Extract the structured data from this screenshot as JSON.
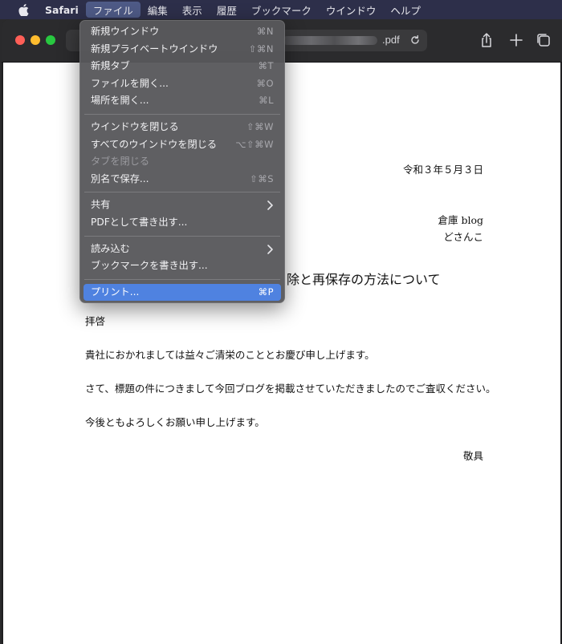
{
  "menubar": {
    "app_name": "Safari",
    "items": [
      "ファイル",
      "編集",
      "表示",
      "履歴",
      "ブックマーク",
      "ウインドウ",
      "ヘルプ"
    ]
  },
  "toolbar": {
    "url_suffix": ".pdf"
  },
  "file_menu": {
    "group1": [
      {
        "label": "新規ウインドウ",
        "shortcut": "⌘N"
      },
      {
        "label": "新規プライベートウインドウ",
        "shortcut": "⇧⌘N"
      },
      {
        "label": "新規タブ",
        "shortcut": "⌘T"
      },
      {
        "label": "ファイルを開く...",
        "shortcut": "⌘O"
      },
      {
        "label": "場所を開く...",
        "shortcut": "⌘L"
      }
    ],
    "group2": [
      {
        "label": "ウインドウを閉じる",
        "shortcut": "⇧⌘W"
      },
      {
        "label": "すべてのウインドウを閉じる",
        "shortcut": "⌥⇧⌘W"
      },
      {
        "label": "タブを閉じる",
        "shortcut": ""
      },
      {
        "label": "別名で保存...",
        "shortcut": "⇧⌘S"
      }
    ],
    "group3": [
      {
        "label": "共有"
      },
      {
        "label": "PDFとして書き出す..."
      }
    ],
    "group4": [
      {
        "label": "読み込む"
      },
      {
        "label": "ブックマークを書き出す..."
      }
    ],
    "group5": [
      {
        "label": "プリント...",
        "shortcut": "⌘P"
      }
    ]
  },
  "document": {
    "date": "令和３年５月３日",
    "org": "倉庫 blog",
    "author": "どさんこ",
    "title_visible": "除と再保存の方法について",
    "salutation": "拝啓",
    "para1": "貴社におかれましては益々ご清栄のこととお慶び申し上げます。",
    "para2": "さて、標題の件につきまして今回ブログを掲載させていただきましたのでご査収ください。",
    "para3": "今後ともよろしくお願い申し上げます。",
    "closing": "敬具"
  },
  "colors": {
    "menubar_bg": "#2d2f4a",
    "menu_highlight": "#4f82e0",
    "close": "#ff5f57",
    "minimize": "#febc2e",
    "zoom": "#28c840"
  }
}
